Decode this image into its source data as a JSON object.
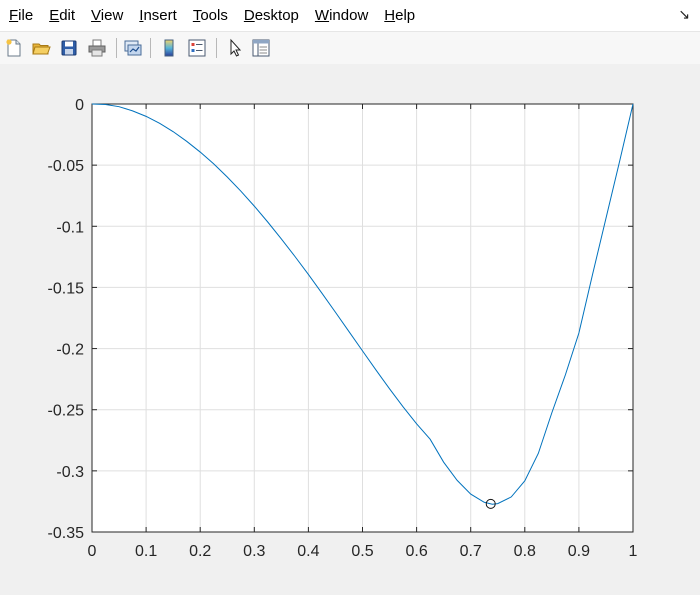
{
  "menu": {
    "items": [
      {
        "label": "File",
        "mnemonic": "F",
        "rest": "ile"
      },
      {
        "label": "Edit",
        "mnemonic": "E",
        "rest": "dit"
      },
      {
        "label": "View",
        "mnemonic": "V",
        "rest": "iew"
      },
      {
        "label": "Insert",
        "mnemonic": "I",
        "rest": "nsert"
      },
      {
        "label": "Tools",
        "mnemonic": "T",
        "rest": "ools"
      },
      {
        "label": "Desktop",
        "mnemonic": "D",
        "rest": "esktop"
      },
      {
        "label": "Window",
        "mnemonic": "W",
        "rest": "indow"
      },
      {
        "label": "Help",
        "mnemonic": "H",
        "rest": "elp"
      }
    ],
    "dock_glyph": "↘"
  },
  "toolbar": {
    "buttons": [
      {
        "name": "new-figure-button",
        "icon": "new-file-icon"
      },
      {
        "name": "open-file-button",
        "icon": "folder-open-icon"
      },
      {
        "name": "save-figure-button",
        "icon": "floppy-disk-icon"
      },
      {
        "name": "print-figure-button",
        "icon": "printer-icon"
      },
      {
        "name": "link-plot-button",
        "icon": "link-plot-icon"
      },
      {
        "name": "insert-colorbar-button",
        "icon": "colorbar-icon"
      },
      {
        "name": "insert-legend-button",
        "icon": "legend-icon"
      },
      {
        "name": "edit-plot-button",
        "icon": "arrow-pointer-icon"
      },
      {
        "name": "property-inspector-button",
        "icon": "property-inspector-icon"
      }
    ]
  },
  "chart_data": {
    "type": "line",
    "title": "",
    "xlabel": "",
    "ylabel": "",
    "xlim": [
      0,
      1
    ],
    "ylim": [
      -0.35,
      0
    ],
    "xticks": [
      0,
      0.1,
      0.2,
      0.3,
      0.4,
      0.5,
      0.6,
      0.7,
      0.8,
      0.9,
      1
    ],
    "xtick_labels": [
      "0",
      "0.1",
      "0.2",
      "0.3",
      "0.4",
      "0.5",
      "0.6",
      "0.7",
      "0.8",
      "0.9",
      "1"
    ],
    "yticks": [
      0,
      -0.05,
      -0.1,
      -0.15,
      -0.2,
      -0.25,
      -0.3,
      -0.35
    ],
    "ytick_labels": [
      "0",
      "-0.05",
      "-0.1",
      "-0.15",
      "-0.2",
      "-0.25",
      "-0.3",
      "-0.35"
    ],
    "grid": true,
    "series": [
      {
        "color": "#0072bd",
        "x": [
          0,
          0.025,
          0.05,
          0.075,
          0.1,
          0.125,
          0.15,
          0.175,
          0.2,
          0.225,
          0.25,
          0.275,
          0.3,
          0.325,
          0.35,
          0.375,
          0.4,
          0.425,
          0.45,
          0.475,
          0.5,
          0.525,
          0.55,
          0.575,
          0.6,
          0.625,
          0.65,
          0.675,
          0.7,
          0.725,
          0.74,
          0.75,
          0.775,
          0.8,
          0.825,
          0.85,
          0.875,
          0.9,
          0.925,
          0.95,
          0.975,
          1.0
        ],
        "y": [
          0,
          -0.0004,
          -0.0022,
          -0.0056,
          -0.0101,
          -0.0158,
          -0.0226,
          -0.0305,
          -0.0393,
          -0.049,
          -0.0597,
          -0.0712,
          -0.0835,
          -0.0966,
          -0.1103,
          -0.1246,
          -0.1394,
          -0.1547,
          -0.1703,
          -0.1861,
          -0.2019,
          -0.2176,
          -0.2329,
          -0.2476,
          -0.2615,
          -0.2741,
          -0.2929,
          -0.3078,
          -0.319,
          -0.3257,
          -0.3273,
          -0.3268,
          -0.3213,
          -0.3082,
          -0.2857,
          -0.2525,
          -0.2215,
          -0.1873,
          -0.1398,
          -0.0935,
          -0.0473,
          0
        ]
      }
    ],
    "marker": {
      "x": 0.737,
      "y": -0.327,
      "shape": "circle"
    }
  }
}
